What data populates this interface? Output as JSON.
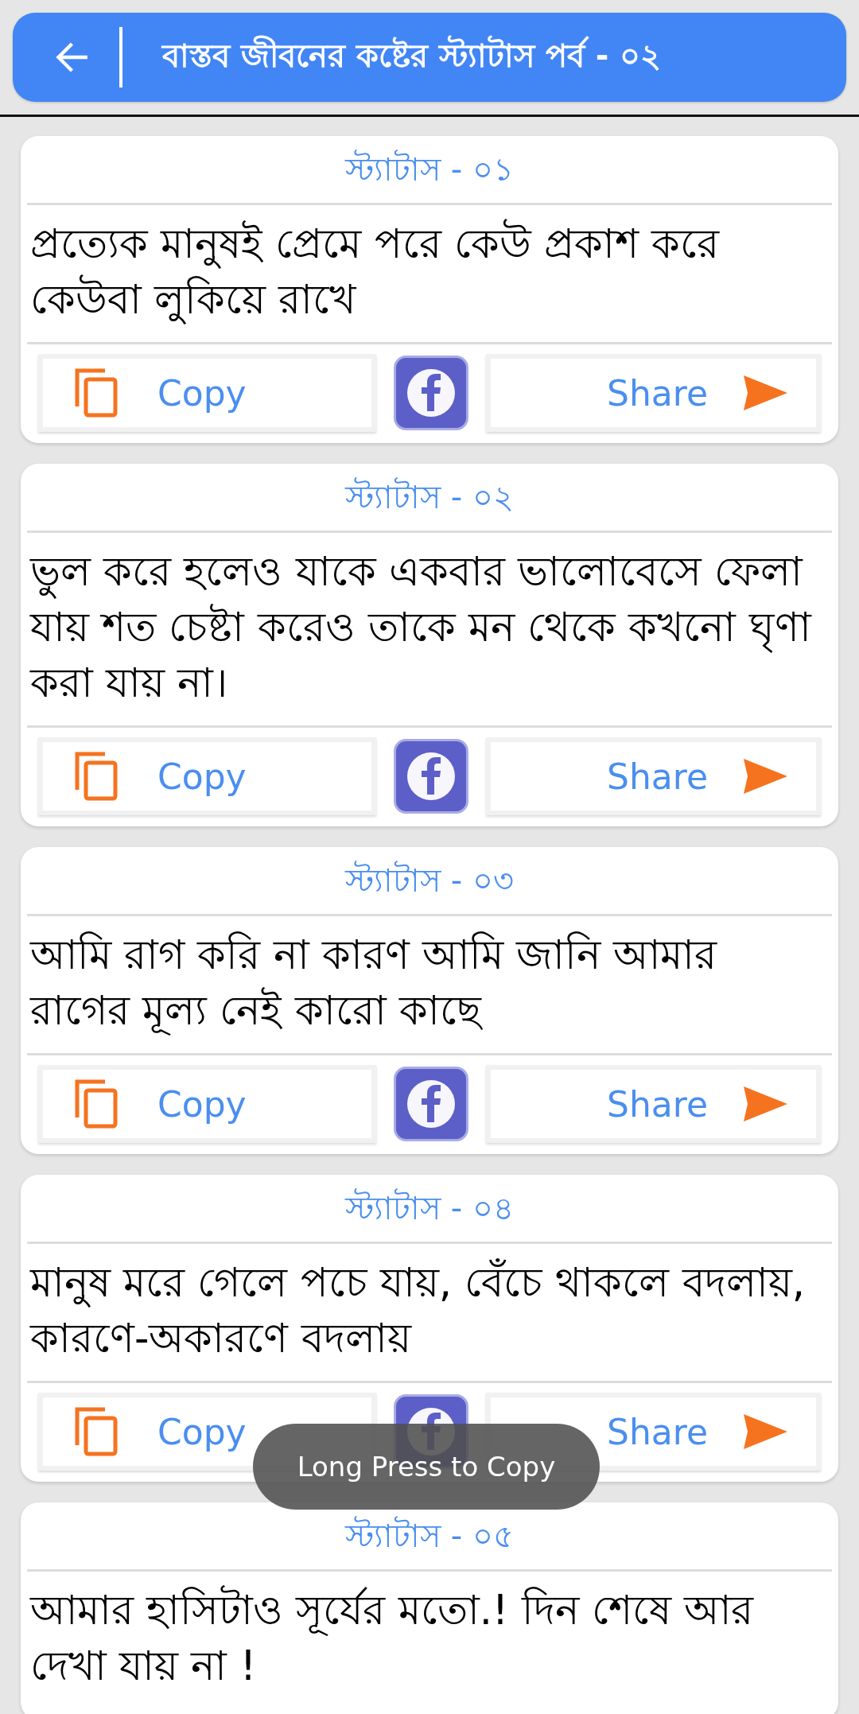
{
  "header": {
    "title": "বাস্তব জীবনের কষ্টের স্ট্যাটাস পর্ব - ০২"
  },
  "cards": [
    {
      "title": "স্ট্যাটাস - ০১",
      "text": "প্রত্যেক মানুষই প্রেমে পরে কেউ প্রকাশ করে কেউবা লুকিয়ে রাখে",
      "copy": "Copy",
      "share": "Share"
    },
    {
      "title": "স্ট্যাটাস - ০২",
      "text": "ভুল করে হলেও যাকে একবার ভালোবেসে ফেলা যায় শত চেষ্টা করেও তাকে মন থেকে কখনো ঘৃণা করা যায় না।",
      "copy": "Copy",
      "share": "Share"
    },
    {
      "title": "স্ট্যাটাস - ০৩",
      "text": "আমি রাগ করি না কারণ আমি জানি আমার রাগের মূল্য নেই কারো কাছে",
      "copy": "Copy",
      "share": "Share"
    },
    {
      "title": "স্ট্যাটাস - ০৪",
      "text": "মানুষ মরে গেলে পচে যায়, বেঁচে থাকলে বদলায়, কারণে-অকারণে বদলায়",
      "copy": "Copy",
      "share": "Share"
    },
    {
      "title": "স্ট্যাটাস - ০৫",
      "text": "আমার হাসিটাও সূর্যের মতো.! দিন শেষে আর দেখা যায় না !"
    }
  ],
  "toast": "Long Press to Copy"
}
